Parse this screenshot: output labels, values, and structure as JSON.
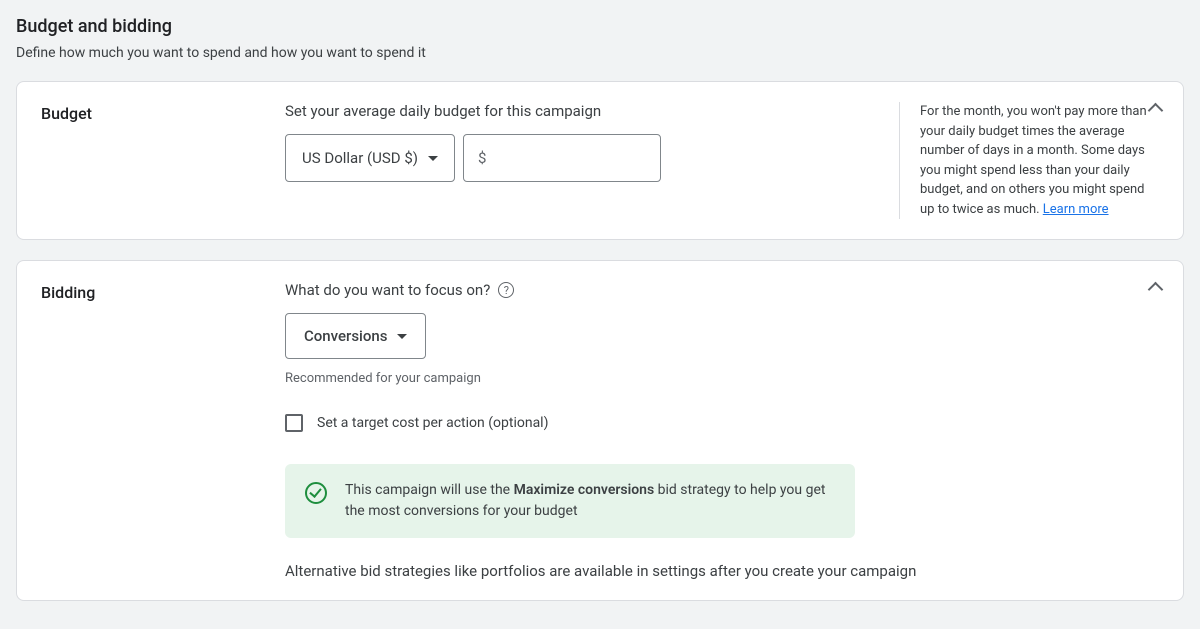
{
  "header": {
    "title": "Budget and bidding",
    "subtitle": "Define how much you want to spend and how you want to spend it"
  },
  "budget": {
    "label": "Budget",
    "field_label": "Set your average daily budget for this campaign",
    "currency_selected": "US Dollar (USD $)",
    "amount_prefix": "$",
    "amount_value": "",
    "side_note": "For the month, you won't pay more than your daily budget times the average number of days in a month. Some days you might spend less than your daily budget, and on others you might spend up to twice as much. ",
    "learn_more": "Learn more"
  },
  "bidding": {
    "label": "Bidding",
    "focus_label": "What do you want to focus on?",
    "help_symbol": "?",
    "focus_selected": "Conversions",
    "recommendation_hint": "Recommended for your campaign",
    "target_checkbox_label": "Set a target cost per action (optional)",
    "banner_prefix": "This campaign will use the ",
    "banner_bold": "Maximize conversions",
    "banner_suffix": " bid strategy to help you get the most conversions for your budget",
    "alt_note": "Alternative bid strategies like portfolios are available in settings after you create your campaign"
  }
}
